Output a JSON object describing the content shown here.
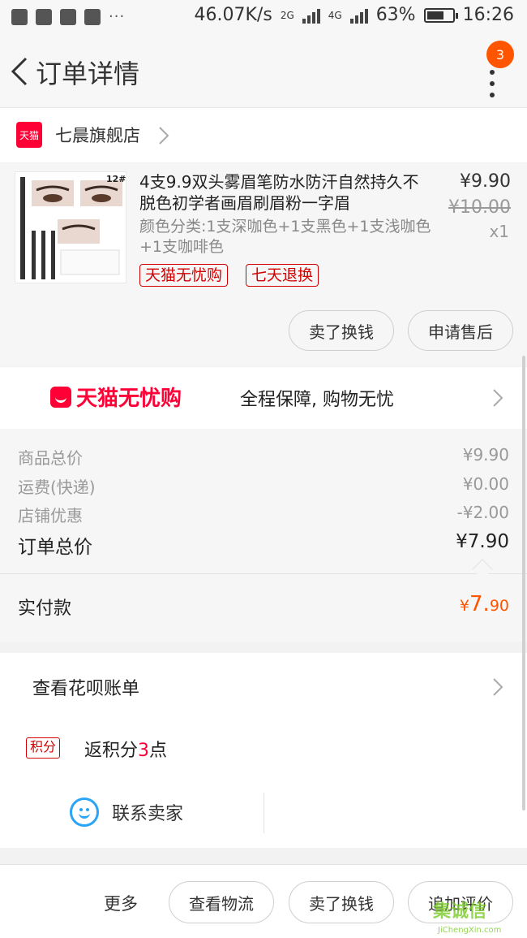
{
  "status_bar": {
    "speed": "46.07K/s",
    "net1": "2G",
    "net2": "4G",
    "battery": "63%",
    "time": "16:26"
  },
  "header": {
    "title": "订单详情",
    "badge_count": "3"
  },
  "store": {
    "logo_text": "天猫",
    "name": "七晨旗舰店"
  },
  "product": {
    "title": "4支9.9双头雾眉笔防水防汗自然持久不脱色初学者画眉刷眉粉一字眉",
    "spec": "颜色分类:1支深咖色+1支黑色+1支浅咖色+1支咖啡色",
    "price": "¥9.90",
    "original_price": "¥10.00",
    "quantity": "x1",
    "tags": [
      "天猫无忧购",
      "七天退换"
    ],
    "thumb_label": "12#",
    "buttons": [
      "卖了换钱",
      "申请售后"
    ]
  },
  "worry_free": {
    "logo_text": "天猫无忧购",
    "text": "全程保障, 购物无忧"
  },
  "totals": {
    "rows": [
      {
        "label": "商品总价",
        "value": "¥9.90"
      },
      {
        "label": "运费(快递)",
        "value": "¥0.00"
      },
      {
        "label": "店铺优惠",
        "value": "-¥2.00"
      }
    ],
    "order_total_label": "订单总价",
    "order_total_value": "¥7.90",
    "paid_label": "实付款",
    "paid_currency": "¥",
    "paid_main": "7.",
    "paid_decimal": "90"
  },
  "services": {
    "bill_label": "查看花呗账单",
    "points_tag": "积分",
    "points_prefix": "返积分",
    "points_number": "3",
    "points_suffix": "点",
    "contact_label": "联系卖家"
  },
  "bottom_bar": {
    "more_label": "更多",
    "buttons": [
      "查看物流",
      "卖了换钱",
      "追加评价"
    ]
  },
  "watermark": {
    "main": "集诚信",
    "url": "JiChengXin.com"
  },
  "colors": {
    "accent_orange": "#ff5500",
    "tmall_red": "#ff0036",
    "tag_red": "#d40000",
    "contact_blue": "#2aa4f4"
  }
}
